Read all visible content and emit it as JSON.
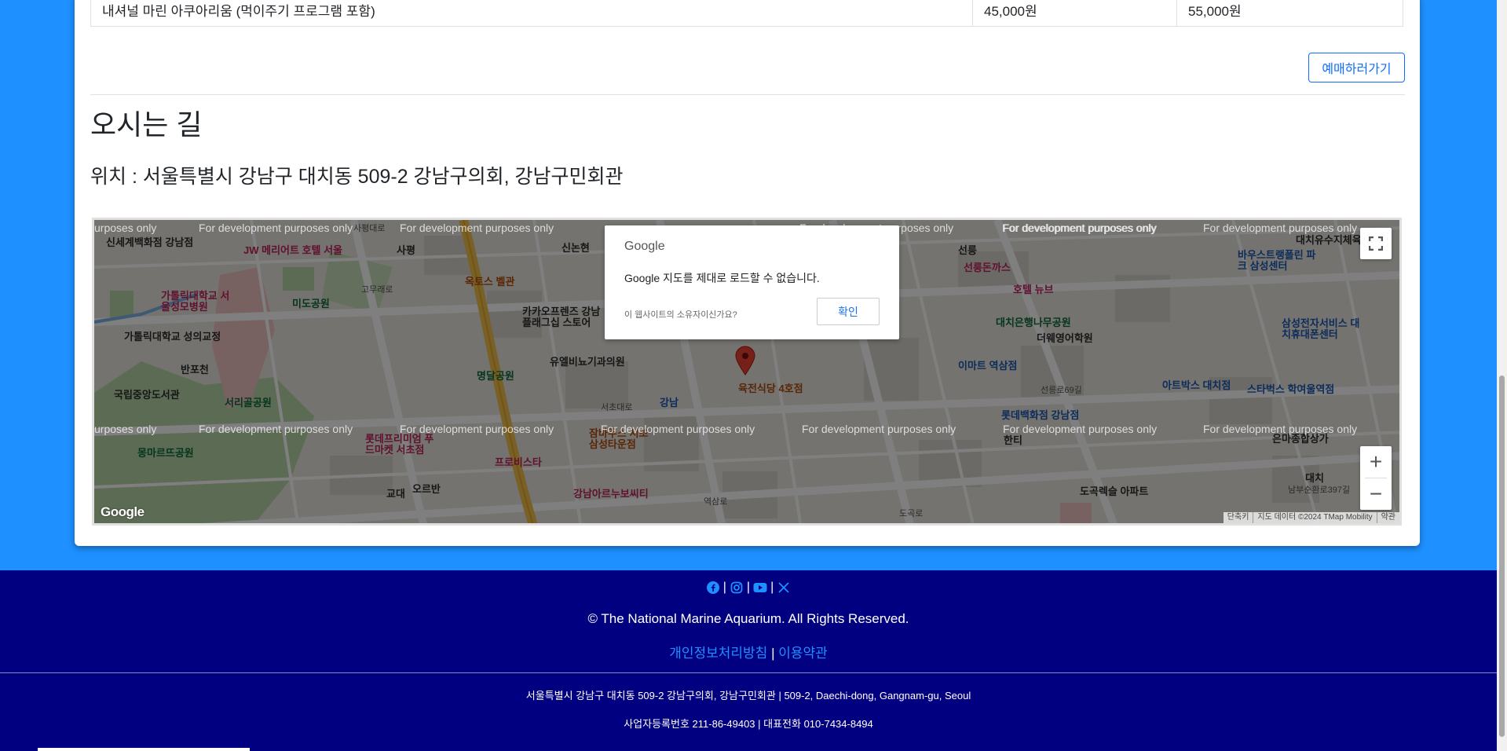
{
  "price_table": {
    "program": "내셔널 마린 아쿠아리움 (먹이주기 프로그램 포함)",
    "price_child": "45,000원",
    "price_adult": "55,000원"
  },
  "book_button": "예매하러가기",
  "directions": {
    "title": "오시는 길",
    "location": "위치 : 서울특별시 강남구 대치동 509-2 강남구의회, 강남구민회관"
  },
  "map": {
    "watermark": "For development purposes only",
    "watermark_partial": "urposes only",
    "dialog": {
      "logo": "Google",
      "message": "Google 지도를 제대로 로드할 수 없습니다.",
      "owner_question": "이 웹사이트의 소유자이신가요?",
      "ok_label": "확인"
    },
    "google_logo": "Google",
    "attribution": [
      "단축키",
      "지도 데이터 ©2024 TMap Mobility",
      "약관"
    ],
    "zoom_in": "+",
    "zoom_out": "−",
    "labels": {
      "l1": "신세계백화점 강남점",
      "l2": "JW 메리어트 호텔 서울",
      "l3": "가톨릭대학교 서울성모병원",
      "l4": "미도공원",
      "l5": "가톨릭대학교 성의교정",
      "l6": "반포천",
      "l7": "국립중앙도서관",
      "l8": "서리골공원",
      "l9": "몽마르뜨공원",
      "l10": "롯데프리미엄 푸드마켓 서초점",
      "l11": "프로비스타",
      "l12": "오르반",
      "l13": "옥토스 벨관",
      "l14": "카카오프렌즈 강남 플래그십 스토어",
      "l15": "명달공원",
      "l16": "유엘비뇨기과의원",
      "l17": "육전식당 4호점",
      "l18": "잠바주스 서초 삼성타운점",
      "l19": "강남아르누보씨티",
      "l20": "선릉돈까스",
      "l21": "호텔 뉴브",
      "l22": "대치은행나무공원",
      "l23": "더웨영어학원",
      "l24": "이마트 역삼점",
      "l25": "롯데백화점 강남점",
      "l26": "도곡렉슬 아파트",
      "l27": "아트박스 대치점",
      "l28": "바우스트랭폴린 파크 삼성센터",
      "l29": "삼성전자서비스 대치휴대폰센터",
      "l30": "스타벅스 학여울역점",
      "l31": "은마종합상가",
      "l32": "대치유수지체육",
      "l33": "선릉로69길",
      "l34": "남부순환로397길",
      "l35": "사평대로",
      "l36": "고무래로",
      "l37": "서초대로",
      "l38": "강남",
      "l39": "역삼로",
      "l40": "도곡로",
      "l41": "교대",
      "l42": "대치",
      "l43": "선릉",
      "l44": "한티",
      "l45": "신논현",
      "l46": "사평"
    }
  },
  "footer": {
    "social": [
      "facebook",
      "instagram",
      "youtube",
      "x"
    ],
    "separator": "|",
    "copyright": "© The National Marine Aquarium. All Rights Reserved.",
    "privacy": "개인정보처리방침",
    "terms": "이용약관",
    "address": "서울특별시 강남구 대치동 509-2 강남구의회, 강남구민회관 | 509-2, Daechi-dong, Gangnam-gu, Seoul",
    "business": "사업자등록번호 211-86-49403 | 대표전화 010-7434-8494"
  },
  "colors": {
    "page_bg": "#1e90ff",
    "footer_bg": "#000080",
    "link": "#1e90ff",
    "primary": "#0d6efd"
  }
}
